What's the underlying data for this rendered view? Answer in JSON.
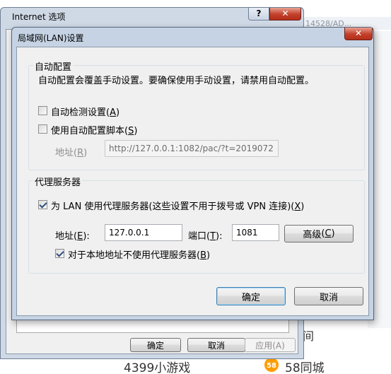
{
  "background": {
    "top_fragment": "14528/AD...",
    "fragment_char": "间",
    "link_games": "4399小游戏",
    "link_58": "58同城",
    "logo_58_text": "58"
  },
  "parent_window": {
    "title": "Internet 选项",
    "help_glyph": "?",
    "close_glyph": "✕",
    "buttons": {
      "ok": "确定",
      "cancel": "取消",
      "apply": "应用(A)"
    }
  },
  "dialog": {
    "title": "局域网(LAN)设置",
    "close_glyph": "✕",
    "auto_config": {
      "group_label": "自动配置",
      "description": "自动配置会覆盖手动设置。要确保使用手动设置，请禁用自动配置。",
      "auto_detect": {
        "label": "自动检测设置",
        "key": "A",
        "checked": false
      },
      "auto_script": {
        "label": "使用自动配置脚本",
        "key": "S",
        "checked": false
      },
      "address_label": "地址",
      "address_key": "R",
      "address_value": "http://127.0.0.1:1082/pac/?t=2019072"
    },
    "proxy": {
      "group_label": "代理服务器",
      "use_proxy": {
        "label": "为 LAN 使用代理服务器(这些设置不用于拨号或 VPN 连接)",
        "key": "X",
        "checked": true
      },
      "address_label": "地址",
      "address_key": "E",
      "address_value": "127.0.0.1",
      "port_label": "端口",
      "port_key": "T",
      "port_value": "1081",
      "advanced_label": "高级",
      "advanced_key": "C",
      "bypass_local": {
        "label": "对于本地地址不使用代理服务器",
        "key": "B",
        "checked": true
      }
    },
    "ok_label": "确定",
    "cancel_label": "取消"
  }
}
